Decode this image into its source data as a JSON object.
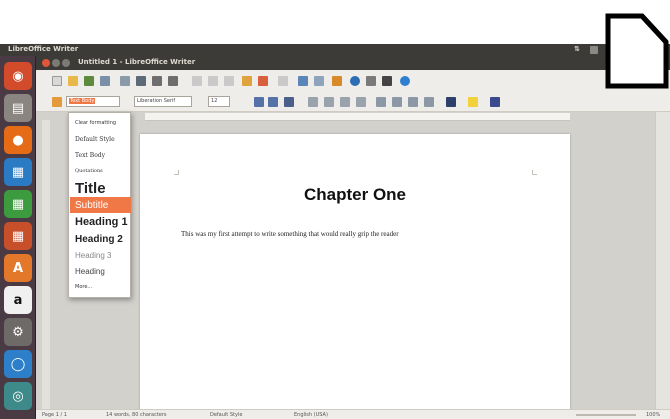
{
  "panel": {
    "app_name": "LibreOffice Writer"
  },
  "window": {
    "title": "Untitled 1 - LibreOffice Writer"
  },
  "formatting": {
    "style_value": "Text Body",
    "font_value": "Liberation Serif",
    "size_value": "12"
  },
  "style_menu": {
    "items": [
      "Clear formatting",
      "Default Style",
      "Text Body",
      "Quotations",
      "Title",
      "Subtitle",
      "Heading 1",
      "Heading 2",
      "Heading 3",
      "Heading",
      "More..."
    ],
    "selected_index": 5
  },
  "document": {
    "heading": "Chapter One",
    "body": "This was my first attempt to write something that would really grip the reader"
  },
  "status": {
    "page": "Page 1 / 1",
    "words": "14 words, 80 characters",
    "style": "Default Style",
    "language": "English (USA)",
    "zoom": "100%"
  },
  "colors": {
    "accent": "#f07746",
    "launcher_bg": "#4a3a44",
    "panel_bg": "#3c3b37"
  },
  "icons": {
    "launcher": [
      "ubuntu-dash-icon",
      "files-icon",
      "firefox-icon",
      "writer-icon",
      "calc-icon",
      "impress-icon",
      "software-center-icon",
      "amazon-icon",
      "settings-icon",
      "ubuntu-one-icon",
      "update-icon"
    ]
  }
}
